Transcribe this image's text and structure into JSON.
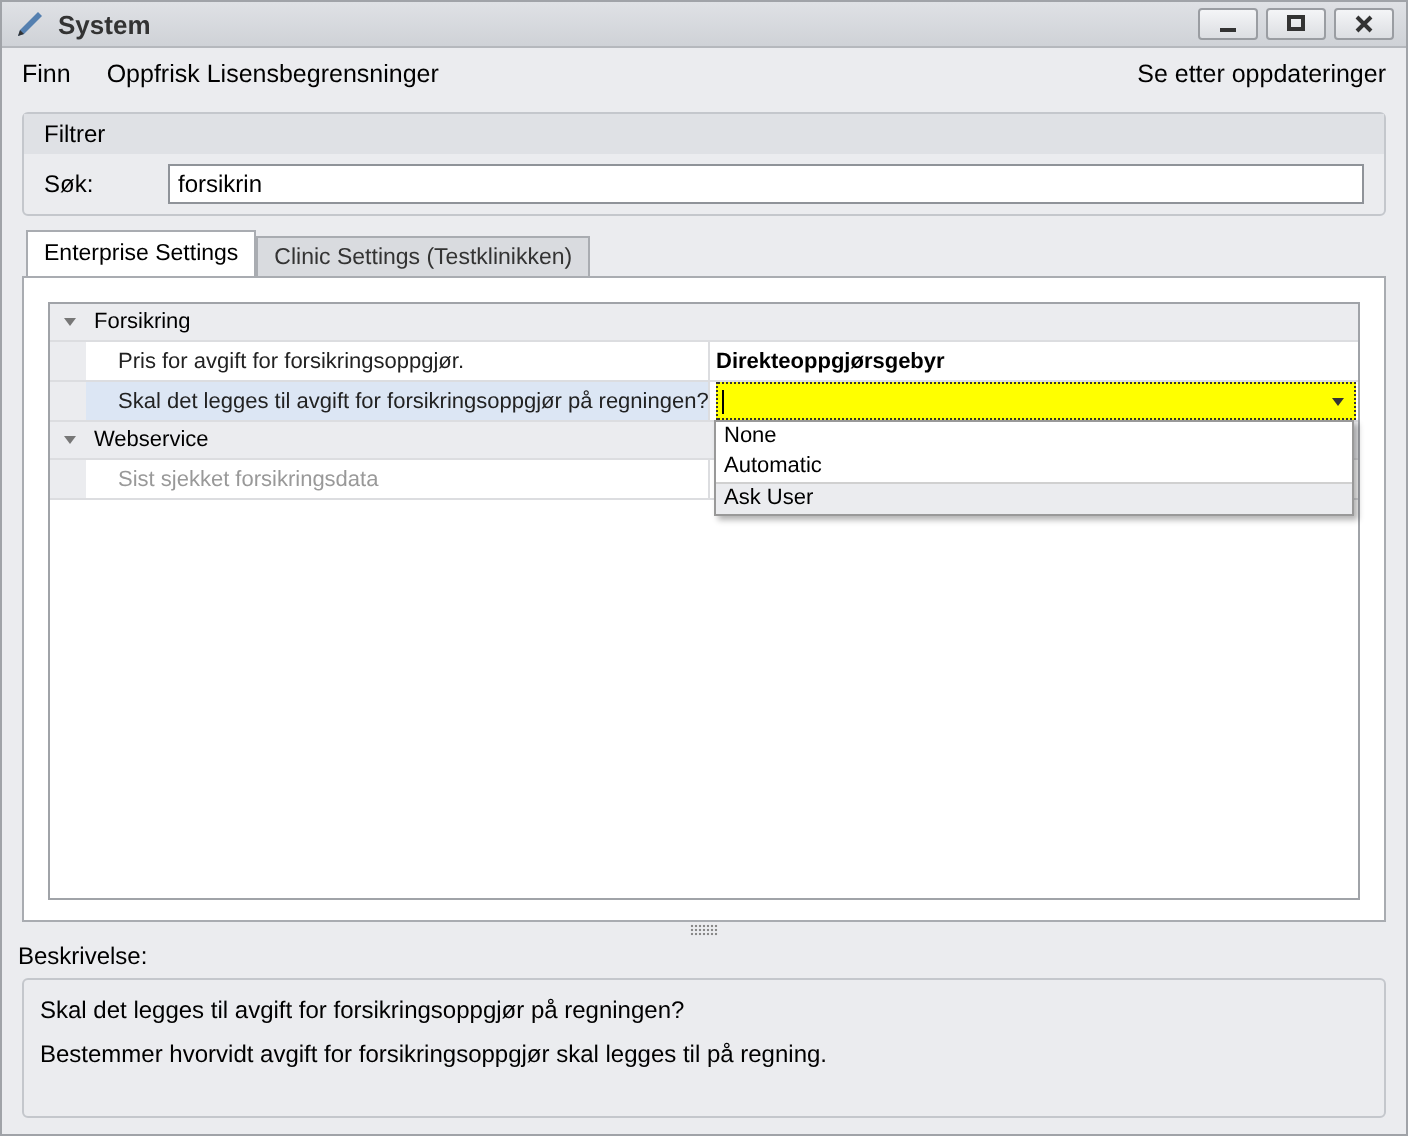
{
  "window": {
    "title": "System"
  },
  "menu": [
    {
      "label": "Finn"
    },
    {
      "label": "Oppfrisk Lisensbegrensninger"
    }
  ],
  "menu_right": {
    "label": "Se etter oppdateringer"
  },
  "filter": {
    "title": "Filtrer",
    "label": "Søk:",
    "value": "forsikrin"
  },
  "tabs": [
    {
      "label": "Enterprise Settings",
      "selected": true
    },
    {
      "label": "Clinic Settings (Testklinikken)",
      "selected": false
    }
  ],
  "property_grid": [
    {
      "category": "Forsikring",
      "expanded": true,
      "rows": [
        {
          "name": "Pris for avgift for forsikringsoppgjør.",
          "value": "Direkteoppgjørsgebyr",
          "selected": false,
          "disabled": false
        },
        {
          "name": "Skal det legges til avgift for forsikringsoppgjør på regningen?",
          "selected": true,
          "disabled": false
        }
      ]
    },
    {
      "category": "Webservice",
      "expanded": true,
      "rows": [
        {
          "name": "Sist sjekket forsikringsdata",
          "selected": false,
          "disabled": true
        }
      ]
    }
  ],
  "dropdown": {
    "options": [
      {
        "label": "None",
        "selected": false
      },
      {
        "label": "Automatic",
        "selected": false
      },
      {
        "label": "Ask User",
        "selected": true
      }
    ]
  },
  "description": {
    "label": "Beskrivelse:",
    "title": "Skal det legges til avgift for forsikringsoppgjør på regningen?",
    "text": "Bestemmer hvorvidt avgift for forsikringsoppgjør skal legges til på regning."
  }
}
